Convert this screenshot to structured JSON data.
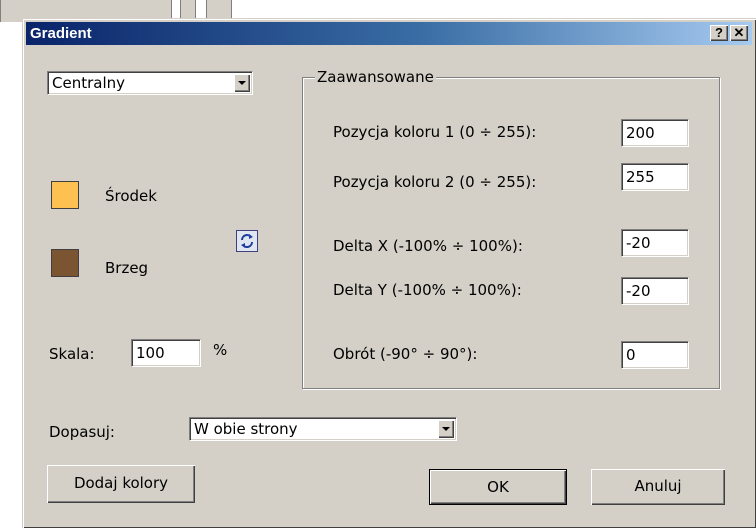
{
  "dialog": {
    "title": "Gradient",
    "help_button": "?",
    "close_button": "✕"
  },
  "gradient_type": {
    "selected": "Centralny"
  },
  "colors": {
    "center": {
      "label": "Środek",
      "color": "#fdc152"
    },
    "edge": {
      "label": "Brzeg",
      "color": "#7b5432"
    },
    "swap_icon": "swap-colors-icon"
  },
  "scale": {
    "label": "Skala:",
    "value": "100",
    "unit": "%"
  },
  "advanced": {
    "legend": "Zaawansowane",
    "fields": [
      {
        "label": "Pozycja koloru 1 (0 ÷ 255):",
        "value": "200"
      },
      {
        "label": "Pozycja koloru 2 (0 ÷ 255):",
        "value": "255"
      },
      {
        "label": "Delta X (-100% ÷ 100%):",
        "value": "-20"
      },
      {
        "label": "Delta Y (-100% ÷ 100%):",
        "value": "-20"
      },
      {
        "label": "Obrót (-90° ÷ 90°):",
        "value": "0"
      }
    ]
  },
  "fit": {
    "label": "Dopasuj:",
    "selected": "W obie strony"
  },
  "buttons": {
    "add_colors": "Dodaj kolory",
    "ok": "OK",
    "cancel": "Anuluj"
  }
}
